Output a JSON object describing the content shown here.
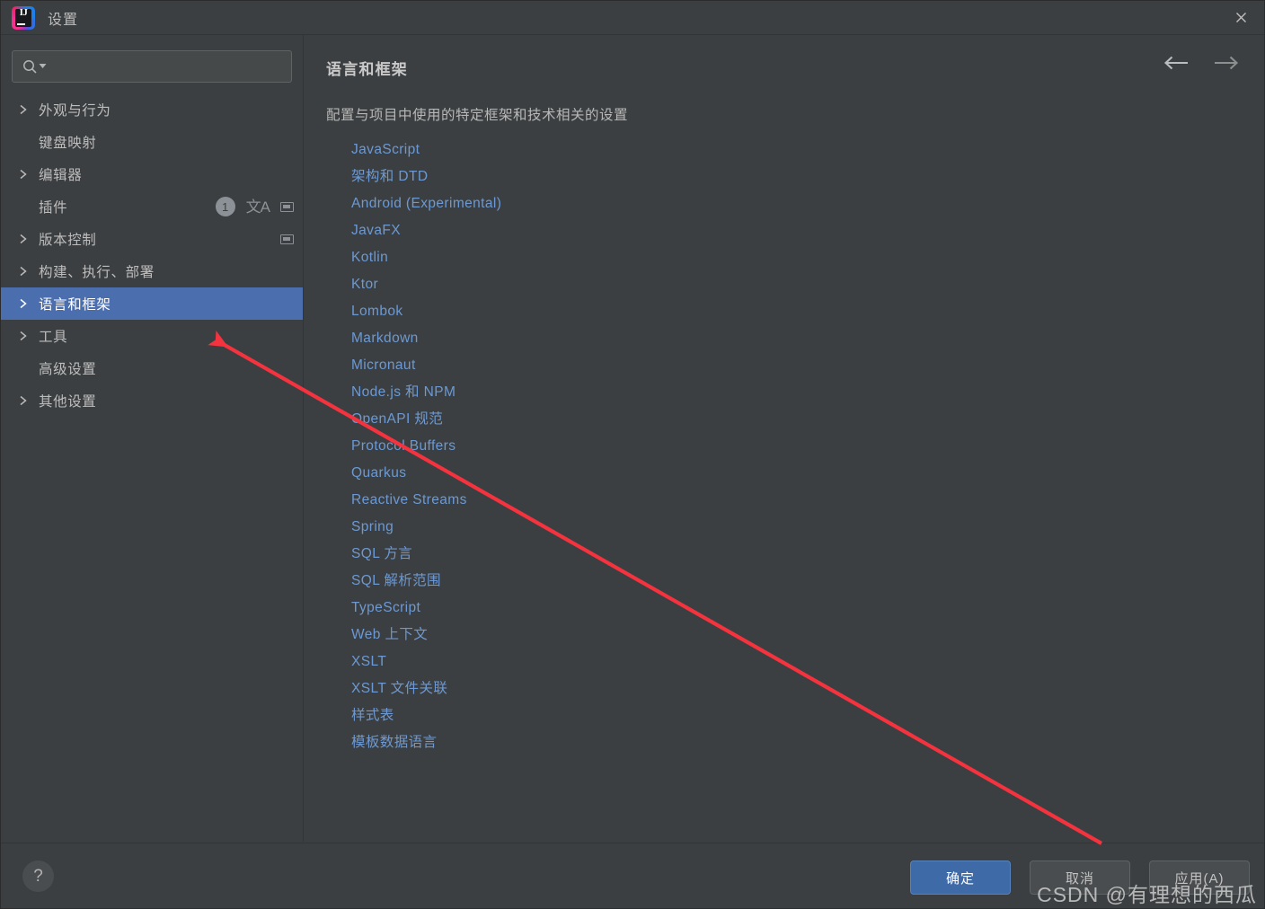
{
  "window": {
    "title": "设置",
    "logo_icon": "intellij-idea-logo",
    "close_icon": "close-icon"
  },
  "sidebar": {
    "search": {
      "icon": "search-icon",
      "value": "",
      "placeholder": ""
    },
    "items": [
      {
        "label": "外观与行为",
        "expandable": true,
        "selected": false,
        "icons": []
      },
      {
        "label": "键盘映射",
        "expandable": false,
        "selected": false,
        "icons": []
      },
      {
        "label": "编辑器",
        "expandable": true,
        "selected": false,
        "icons": []
      },
      {
        "label": "插件",
        "expandable": false,
        "selected": false,
        "icons": [
          "badge",
          "translate-icon",
          "window-icon"
        ],
        "badge": "1"
      },
      {
        "label": "版本控制",
        "expandable": true,
        "selected": false,
        "icons": [
          "window-icon"
        ]
      },
      {
        "label": "构建、执行、部署",
        "expandable": true,
        "selected": false,
        "icons": []
      },
      {
        "label": "语言和框架",
        "expandable": true,
        "selected": true,
        "icons": []
      },
      {
        "label": "工具",
        "expandable": true,
        "selected": false,
        "icons": []
      },
      {
        "label": "高级设置",
        "expandable": false,
        "selected": false,
        "icons": []
      },
      {
        "label": "其他设置",
        "expandable": true,
        "selected": false,
        "icons": []
      }
    ]
  },
  "main": {
    "title": "语言和框架",
    "description": "配置与项目中使用的特定框架和技术相关的设置",
    "nav": {
      "back_icon": "arrow-left-icon",
      "forward_icon": "arrow-right-icon"
    },
    "links": [
      "JavaScript",
      "架构和 DTD",
      "Android (Experimental)",
      "JavaFX",
      "Kotlin",
      "Ktor",
      "Lombok",
      "Markdown",
      "Micronaut",
      "Node.js 和 NPM",
      "OpenAPI 规范",
      "Protocol Buffers",
      "Quarkus",
      "Reactive Streams",
      "Spring",
      "SQL 方言",
      "SQL 解析范围",
      "TypeScript",
      "Web 上下文",
      "XSLT",
      "XSLT 文件关联",
      "样式表",
      "模板数据语言"
    ]
  },
  "footer": {
    "help_icon": "help-question-icon",
    "help_label": "?",
    "ok_label": "确定",
    "cancel_label": "取消",
    "apply_label": "应用(A)"
  },
  "annotation": {
    "arrow_color": "#f5333f",
    "arrow_name": "red-annotation-arrow"
  },
  "watermark": {
    "text": "CSDN @有理想的西瓜"
  },
  "colors": {
    "background": "#3c3f41",
    "selection": "#4b6eaf",
    "link": "#6c99d3",
    "primary_button": "#3f6aa8",
    "text": "#bdbdbd"
  }
}
